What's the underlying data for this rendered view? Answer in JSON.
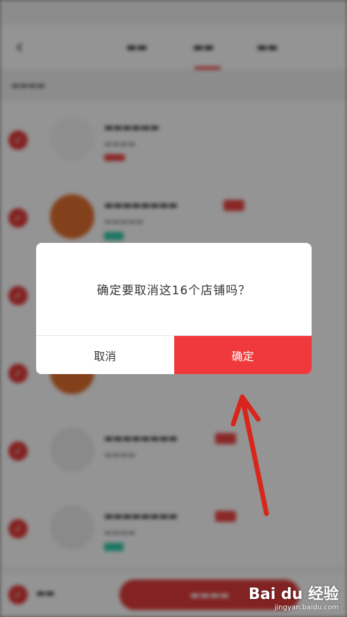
{
  "dialog": {
    "message": "确定要取消这16个店铺吗？",
    "cancel_label": "取消",
    "confirm_label": "确定",
    "confirm_color": "#f0393c"
  },
  "background": {
    "back_icon": "chevron-left-icon",
    "accent_color": "#e23b3b"
  },
  "watermark": {
    "brand": "Bai du 经验",
    "url": "jingyan.baidu.com"
  },
  "annotation": {
    "arrow_color": "#d9261c"
  }
}
